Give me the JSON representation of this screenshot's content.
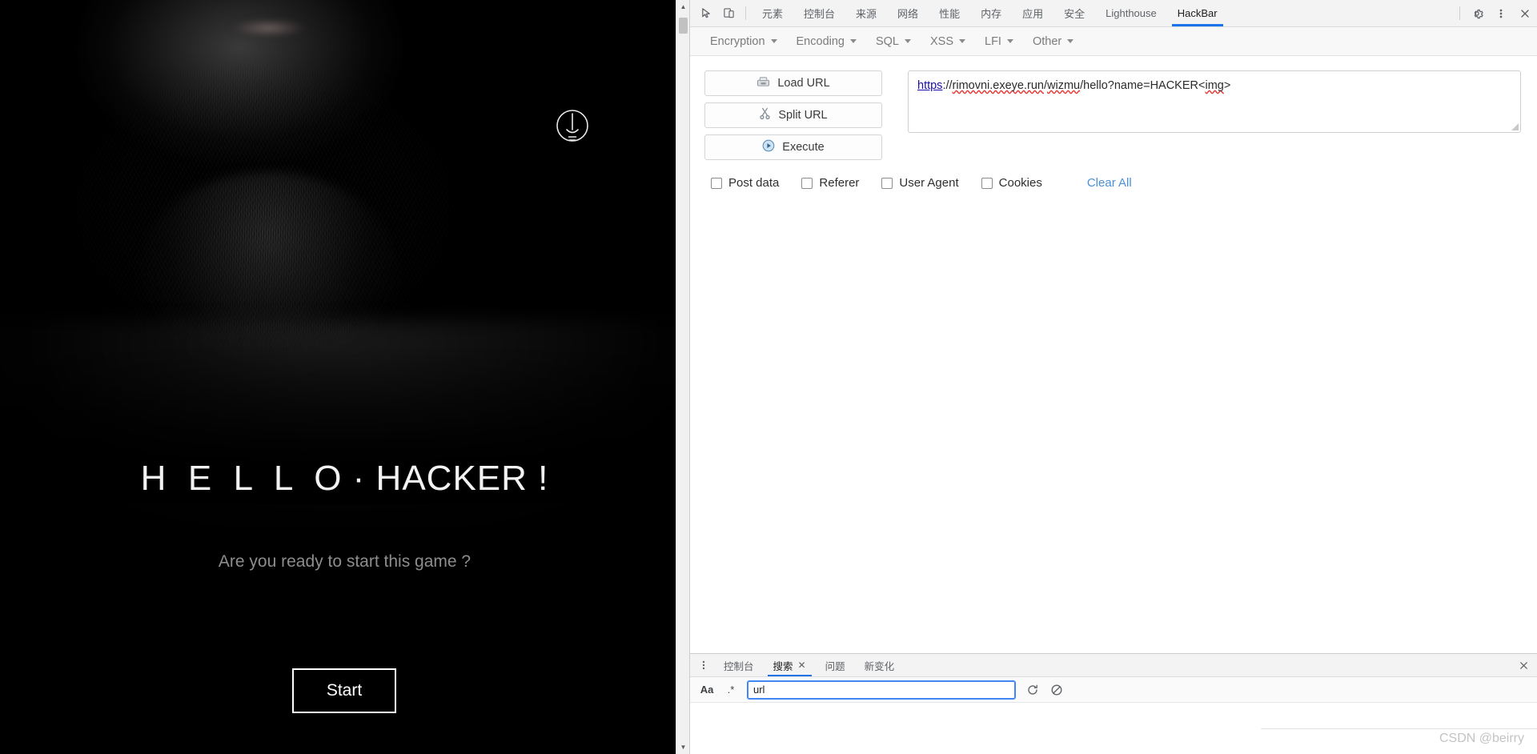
{
  "page": {
    "title": "H  E  L  L  O · HACKER !",
    "subtitle": "Are you ready to start this game ?",
    "start_button": "Start",
    "bulb_icon": "lightbulb-icon",
    "background": "#000000"
  },
  "devtools": {
    "inspect_icon": "inspect-element-icon",
    "device_icon": "device-toolbar-icon",
    "tabs": [
      {
        "label": "元素",
        "active": false
      },
      {
        "label": "控制台",
        "active": false
      },
      {
        "label": "来源",
        "active": false
      },
      {
        "label": "网络",
        "active": false
      },
      {
        "label": "性能",
        "active": false
      },
      {
        "label": "内存",
        "active": false
      },
      {
        "label": "应用",
        "active": false
      },
      {
        "label": "安全",
        "active": false
      },
      {
        "label": "Lighthouse",
        "active": false
      },
      {
        "label": "HackBar",
        "active": true
      }
    ],
    "settings_icon": "gear-icon",
    "more_icon": "kebab-menu-icon",
    "close_icon": "close-icon",
    "accent_color": "#1a73e8"
  },
  "hackbar": {
    "menus": [
      {
        "label": "Encryption"
      },
      {
        "label": "Encoding"
      },
      {
        "label": "SQL"
      },
      {
        "label": "XSS"
      },
      {
        "label": "LFI"
      },
      {
        "label": "Other"
      }
    ],
    "buttons": [
      {
        "label": "Load URL",
        "icon": "load-url-icon"
      },
      {
        "label": "Split URL",
        "icon": "scissors-icon"
      },
      {
        "label": "Execute",
        "icon": "play-icon"
      }
    ],
    "url_value": "https://rimovni.exeye.run/wizmu/hello?name=HACKER<img>",
    "url_parts": {
      "scheme": "https",
      "sep": "://",
      "host": "rimovni.exeye.run",
      "slash1": "/",
      "path1": "wizmu",
      "slash2": "/",
      "path2": "hello?name=HACKER<",
      "tag": "img",
      "close": ">"
    },
    "options": [
      {
        "label": "Post data",
        "checked": false
      },
      {
        "label": "Referer",
        "checked": false
      },
      {
        "label": "User Agent",
        "checked": false
      },
      {
        "label": "Cookies",
        "checked": false
      }
    ],
    "clear_all": "Clear All",
    "clear_all_color": "#4a90d9"
  },
  "drawer": {
    "kebab_icon": "kebab-menu-icon",
    "tabs": [
      {
        "label": "控制台",
        "active": false,
        "closable": false
      },
      {
        "label": "搜索",
        "active": true,
        "closable": true
      },
      {
        "label": "问题",
        "active": false,
        "closable": false
      },
      {
        "label": "新变化",
        "active": false,
        "closable": false
      }
    ],
    "close_icon": "close-icon",
    "search": {
      "match_case_label": "Aa",
      "regex_label": ".*",
      "value": "url",
      "refresh_icon": "refresh-icon",
      "clear_icon": "clear-icon"
    }
  },
  "watermark": "CSDN @beirry"
}
